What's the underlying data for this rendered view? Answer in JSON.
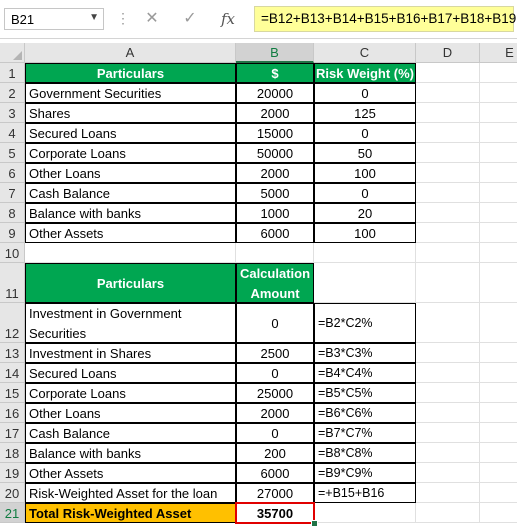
{
  "namebox": {
    "value": "B21"
  },
  "formula_bar": {
    "formula": "=B12+B13+B14+B15+B16+B17+B18+B19"
  },
  "columns": [
    "A",
    "B",
    "C",
    "D",
    "E"
  ],
  "rows": [
    "1",
    "2",
    "3",
    "4",
    "5",
    "6",
    "7",
    "8",
    "9",
    "10",
    "11",
    "12",
    "13",
    "14",
    "15",
    "16",
    "17",
    "18",
    "19",
    "20",
    "21"
  ],
  "table1": {
    "headers": [
      "Particulars",
      "$",
      "Risk Weight (%)"
    ],
    "rows": [
      [
        "Government Securities",
        "20000",
        "0"
      ],
      [
        "Shares",
        "2000",
        "125"
      ],
      [
        "Secured Loans",
        "15000",
        "0"
      ],
      [
        "Corporate Loans",
        "50000",
        "50"
      ],
      [
        "Other Loans",
        "2000",
        "100"
      ],
      [
        "Cash Balance",
        "5000",
        "0"
      ],
      [
        "Balance with banks",
        "1000",
        "20"
      ],
      [
        "Other Assets",
        "6000",
        "100"
      ]
    ]
  },
  "table2": {
    "headers": [
      "Particulars",
      "Calculation Amount"
    ],
    "rows": [
      [
        "Investment in Government Securities",
        "0",
        "=B2*C2%"
      ],
      [
        "Investment in Shares",
        "2500",
        "=B3*C3%"
      ],
      [
        "Secured Loans",
        "0",
        "=B4*C4%"
      ],
      [
        "Corporate Loans",
        "25000",
        "=B5*C5%"
      ],
      [
        "Other Loans",
        "2000",
        "=B6*C6%"
      ],
      [
        "Cash Balance",
        "0",
        "=B7*C7%"
      ],
      [
        "Balance with banks",
        "200",
        "=B8*C8%"
      ],
      [
        "Other Assets",
        "6000",
        "=B9*C9%"
      ],
      [
        "Risk-Weighted Asset for the loan",
        "27000",
        "=+B15+B16"
      ]
    ],
    "total_label": "Total Risk-Weighted Asset",
    "total_value": "35700"
  },
  "colors": {
    "header_green": "#00a651",
    "total_orange": "#ffc000",
    "selection_red": "#e00000",
    "formula_yellow": "#ffff99"
  }
}
